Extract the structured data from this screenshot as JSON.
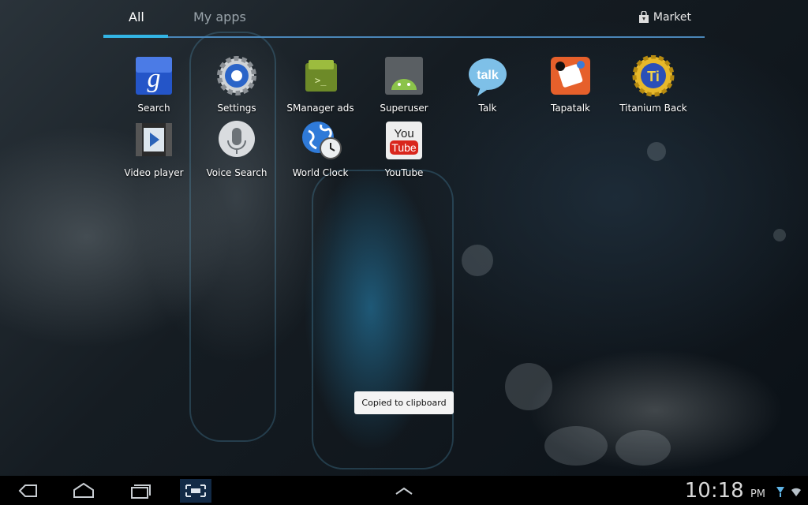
{
  "tabs": {
    "all": "All",
    "my_apps": "My apps",
    "market": "Market"
  },
  "apps": [
    {
      "label": "Search",
      "icon": "google-search-icon"
    },
    {
      "label": "Settings",
      "icon": "settings-gear-icon"
    },
    {
      "label": "SManager ads",
      "icon": "smanager-icon"
    },
    {
      "label": "Superuser",
      "icon": "superuser-android-icon"
    },
    {
      "label": "Talk",
      "icon": "talk-icon"
    },
    {
      "label": "Tapatalk",
      "icon": "tapatalk-icon"
    },
    {
      "label": "Titanium Back",
      "icon": "titanium-backup-icon"
    },
    {
      "label": "Video player",
      "icon": "video-player-icon"
    },
    {
      "label": "Voice Search",
      "icon": "microphone-icon"
    },
    {
      "label": "World Clock",
      "icon": "world-clock-icon"
    },
    {
      "label": "YouTube",
      "icon": "youtube-icon"
    }
  ],
  "toast": "Copied to clipboard",
  "navbar": {
    "time": "10:18",
    "ampm": "PM"
  },
  "colors": {
    "accent": "#33b5e5",
    "toast_bg": "#f4f4f4"
  }
}
